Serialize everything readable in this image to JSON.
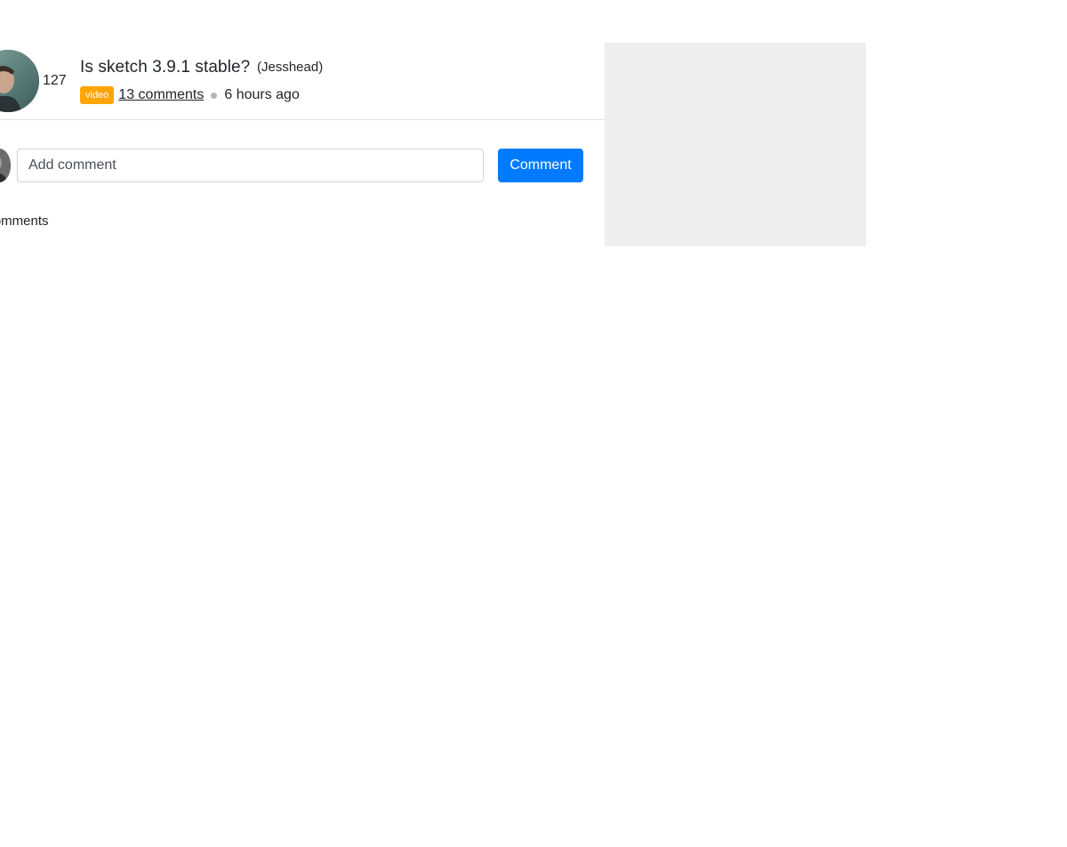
{
  "post": {
    "votes": "127",
    "title": "Is sketch 3.9.1 stable?",
    "author": "(Jesshead)",
    "badge": "video",
    "comments_link": "13 comments ",
    "time_ago": "6 hours ago"
  },
  "comment_form": {
    "placeholder": "Add comment",
    "button_label": "Comment"
  },
  "comments_section": {
    "heading": "Comments"
  },
  "colors": {
    "badge": "#ffa500",
    "primary_button": "#007bff",
    "sidebar_placeholder": "#eeeeee",
    "divider": "#dee2e6"
  }
}
